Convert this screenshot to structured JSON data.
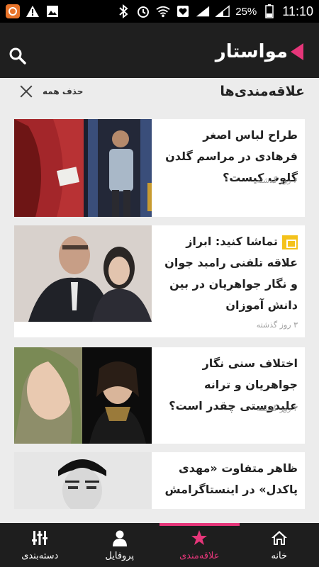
{
  "statusbar": {
    "battery_text": "25%",
    "time": "11:10"
  },
  "header": {
    "logo_text": "مواستار",
    "accent": "#e6367a"
  },
  "page": {
    "title": "علاقه‌مندی‌ها",
    "clear_all_label": "حذف همه"
  },
  "cards": [
    {
      "headline": "طراح لباس اصغر فرهادی در مراسم گلدن گلوب کیست؟",
      "time": "۶ روز گذشته",
      "is_video": false
    },
    {
      "headline": "تماشا کنید: ابراز علاقه تلفنی رامبد جوان و نگار جواهریان در بین دانش آموزان",
      "time": "۳ روز گذشته",
      "is_video": true
    },
    {
      "headline": "اختلاف سنی نگار جواهریان و ترانه علیدوستی چقدر است؟",
      "time": "۳ روز گذشته",
      "is_video": false
    },
    {
      "headline": "ظاهر متفاوت «مهدی پاکدل» در اینستاگرامش",
      "time": "",
      "is_video": false
    }
  ],
  "bottomnav": [
    {
      "label": "دسته‌بندی",
      "icon": "equalizer-icon",
      "active": false
    },
    {
      "label": "پروفایل",
      "icon": "person-icon",
      "active": false
    },
    {
      "label": "علاقه‌مندی",
      "icon": "star-icon",
      "active": true
    },
    {
      "label": "خانه",
      "icon": "home-icon",
      "active": false
    }
  ]
}
